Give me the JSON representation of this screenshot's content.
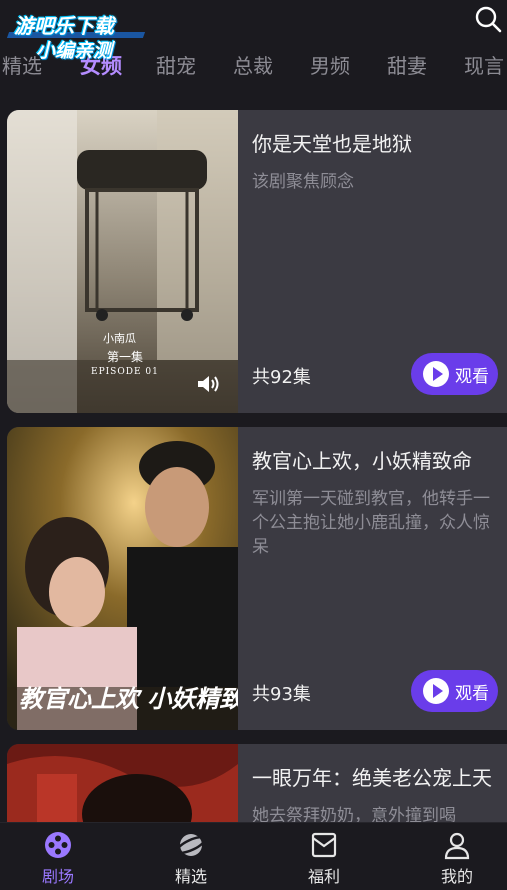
{
  "watermark": {
    "line1": "游吧乐下载",
    "line2": "小编亲测"
  },
  "header": {
    "search_icon": "search-icon"
  },
  "tabs": [
    {
      "label": "精选",
      "active": false
    },
    {
      "label": "女频",
      "active": true
    },
    {
      "label": "甜宠",
      "active": false
    },
    {
      "label": "总裁",
      "active": false
    },
    {
      "label": "男频",
      "active": false
    },
    {
      "label": "甜妻",
      "active": false
    },
    {
      "label": "现言",
      "active": false
    }
  ],
  "dramas": [
    {
      "title": "你是天堂也是地狱",
      "desc": "该剧聚焦顾念",
      "episodes": "共92集",
      "watch": "观看",
      "poster_text": {
        "brand": "小南瓜",
        "episode_cn": "第一集",
        "episode_en": "EPISODE 01"
      }
    },
    {
      "title": "教官心上欢，小妖精致命",
      "desc": "军训第一天碰到教官，他转手一个公主抱让她小鹿乱撞，众人惊呆",
      "episodes": "共93集",
      "watch": "观看",
      "poster_text": {
        "overlay": "教官心上欢 小妖精致命"
      }
    },
    {
      "title": "一眼万年：绝美老公宠上天",
      "desc": "她去祭拜奶奶，意外撞到喝",
      "episodes": "",
      "watch": ""
    }
  ],
  "bottom_nav": [
    {
      "label": "剧场",
      "icon": "theater-icon",
      "active": true
    },
    {
      "label": "精选",
      "icon": "planet-icon",
      "active": false
    },
    {
      "label": "福利",
      "icon": "gift-envelope-icon",
      "active": false
    },
    {
      "label": "我的",
      "icon": "user-icon",
      "active": false
    }
  ],
  "colors": {
    "accent": "#6a3dea",
    "tab_active": "#b48cff",
    "background": "#1b1a1f",
    "card": "#3b3a42"
  }
}
